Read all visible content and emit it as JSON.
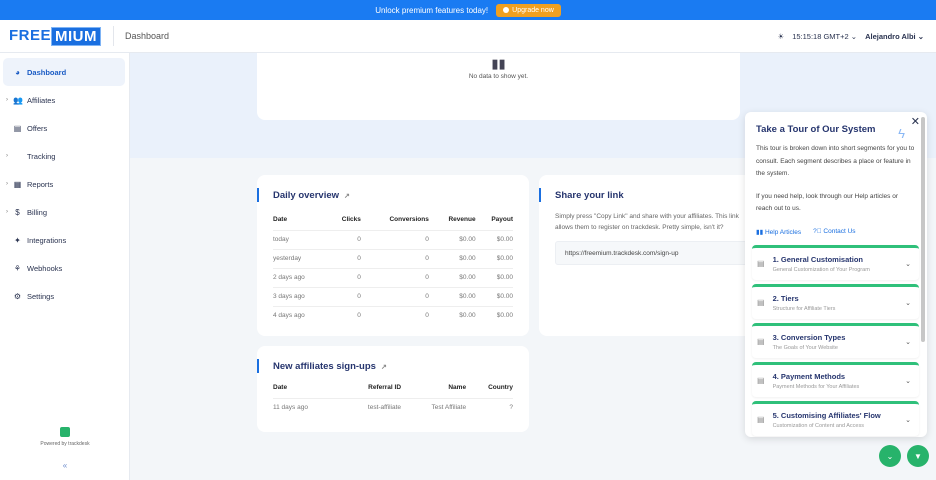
{
  "promo": {
    "text": "Unlock premium features today!",
    "button": "Upgrade now"
  },
  "header": {
    "logo_a": "FREE",
    "logo_b": "MIUM",
    "breadcrumb": "Dashboard",
    "time": "15:15:18 GMT+2",
    "user": "Alejandro Albi"
  },
  "sidebar": {
    "items": [
      {
        "label": "Dashboard",
        "icon": "pie-chart-icon",
        "expandable": false
      },
      {
        "label": "Affiliates",
        "icon": "users-icon",
        "expandable": true
      },
      {
        "label": "Offers",
        "icon": "offer-icon",
        "expandable": false
      },
      {
        "label": "Tracking",
        "icon": "code-icon",
        "expandable": true
      },
      {
        "label": "Reports",
        "icon": "report-icon",
        "expandable": true
      },
      {
        "label": "Billing",
        "icon": "dollar-icon",
        "expandable": true
      },
      {
        "label": "Integrations",
        "icon": "puzzle-icon",
        "expandable": false
      },
      {
        "label": "Webhooks",
        "icon": "webhook-icon",
        "expandable": false
      },
      {
        "label": "Settings",
        "icon": "gear-icon",
        "expandable": false
      }
    ],
    "powered": "Powered by trackdesk"
  },
  "chart_card": {
    "empty": "No data to show yet."
  },
  "daily": {
    "title": "Daily overview",
    "headers": [
      "Date",
      "Clicks",
      "Conversions",
      "Revenue",
      "Payout"
    ],
    "rows": [
      [
        "today",
        "0",
        "0",
        "$0.00",
        "$0.00"
      ],
      [
        "yesterday",
        "0",
        "0",
        "$0.00",
        "$0.00"
      ],
      [
        "2 days ago",
        "0",
        "0",
        "$0.00",
        "$0.00"
      ],
      [
        "3 days ago",
        "0",
        "0",
        "$0.00",
        "$0.00"
      ],
      [
        "4 days ago",
        "0",
        "0",
        "$0.00",
        "$0.00"
      ]
    ]
  },
  "share": {
    "title": "Share your link",
    "text": "Simply press \"Copy Link\" and share with your affiliates. This link allows them to register on trackdesk. Pretty simple, isn't it?",
    "url": "https://freemium.trackdesk.com/sign-up"
  },
  "signups": {
    "title": "New affiliates sign-ups",
    "headers": [
      "Date",
      "Referral ID",
      "Name",
      "Country"
    ],
    "rows": [
      [
        "11 days ago",
        "test-affiliate",
        "Test Affiliate",
        "?"
      ]
    ]
  },
  "tour": {
    "title": "Take a Tour of Our System",
    "p1": "This tour is broken down into short segments for you to consult. Each segment describes a place or feature in the system.",
    "p2": "If you need help, look through our Help articles or reach out to us.",
    "help": "Help Articles",
    "contact": "Contact Us",
    "segments": [
      {
        "title": "1. General Customisation",
        "sub": "General Customization of Your Program"
      },
      {
        "title": "2. Tiers",
        "sub": "Structure for Affiliate Tiers"
      },
      {
        "title": "3. Conversion Types",
        "sub": "The Goals of Your Website"
      },
      {
        "title": "4. Payment Methods",
        "sub": "Payment Methods for Your Affiliates"
      },
      {
        "title": "5. Customising Affiliates' Flow",
        "sub": "Customization of Content and Access"
      }
    ]
  },
  "colors": {
    "accent": "#1a7bf2",
    "green": "#27b36b",
    "orange": "#f0a020"
  }
}
